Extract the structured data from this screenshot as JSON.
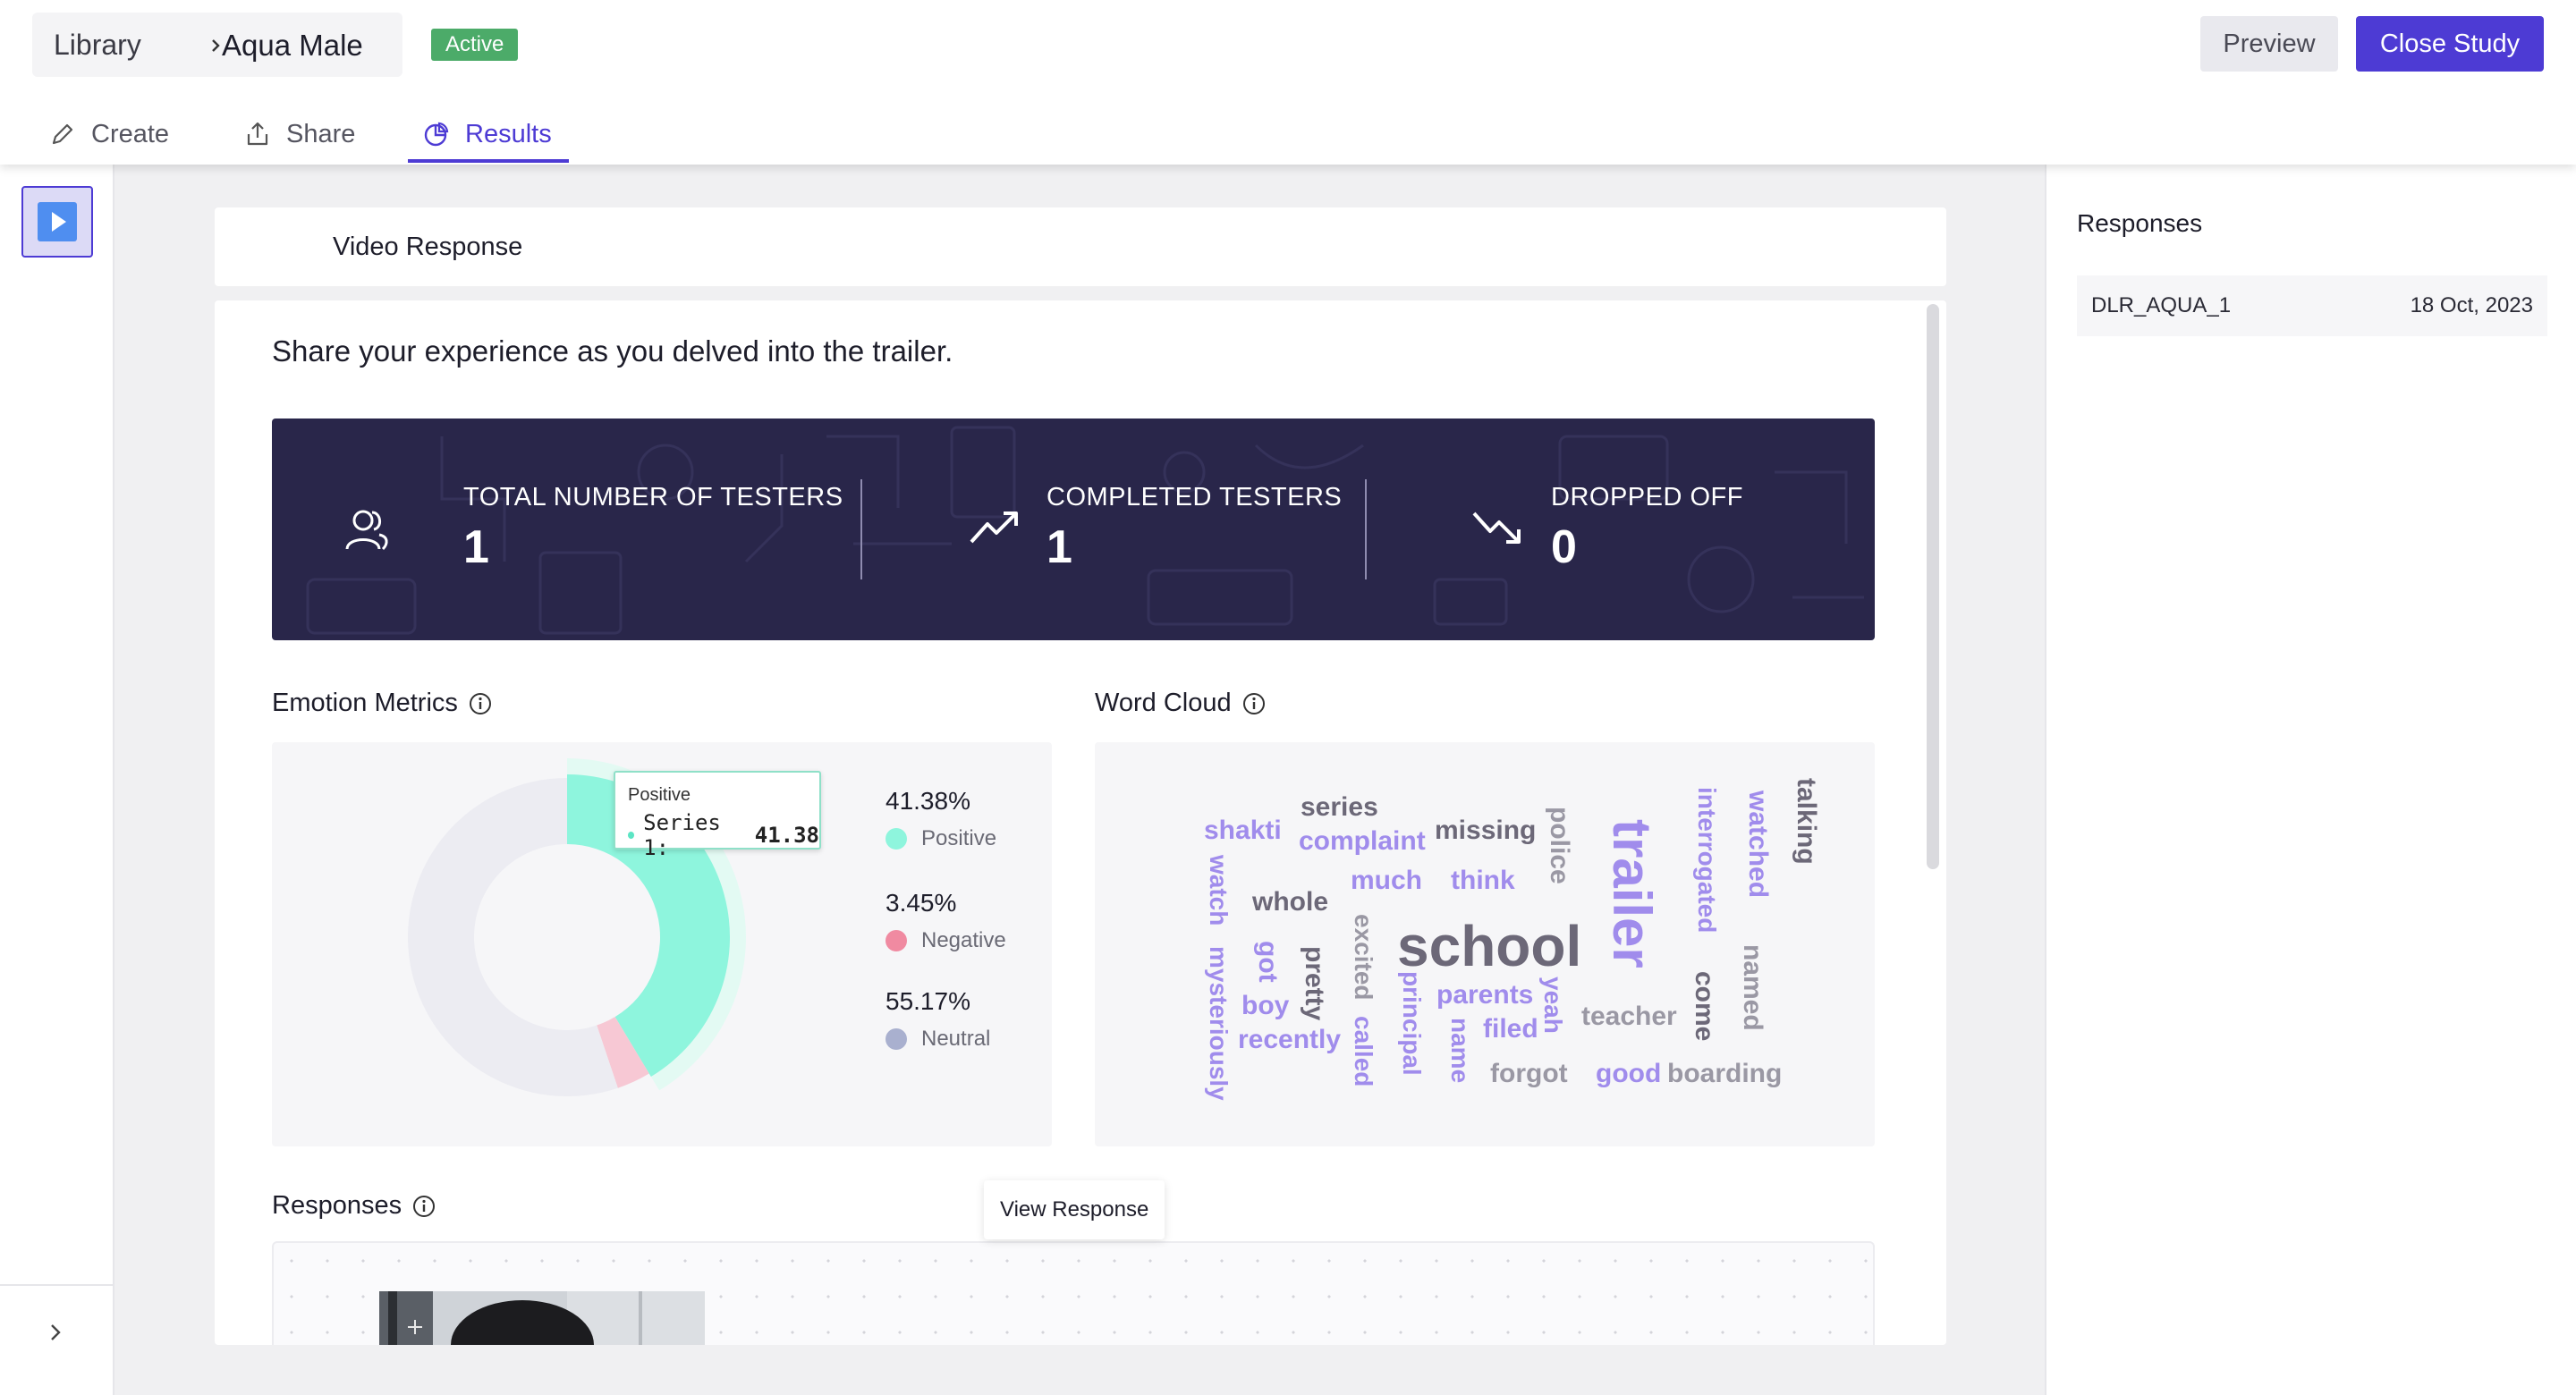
{
  "header": {
    "breadcrumb_root": "Library",
    "study_name": "Aqua Male",
    "status_badge": "Active",
    "preview_label": "Preview",
    "close_label": "Close Study",
    "tabs": [
      {
        "label": "Create",
        "icon": "pencil-icon"
      },
      {
        "label": "Share",
        "icon": "share-upload-icon"
      },
      {
        "label": "Results",
        "icon": "pie-chart-icon",
        "active": true
      }
    ]
  },
  "sidebar": {
    "items": [
      {
        "icon": "video-play-icon",
        "selected": true
      }
    ],
    "expand_icon": "chevron-right-icon"
  },
  "section": {
    "title": "Video Response"
  },
  "question": "Share your experience as you delved into the trailer.",
  "stats": [
    {
      "label": "TOTAL NUMBER OF TESTERS",
      "value": "1",
      "icon": "users-icon"
    },
    {
      "label": "COMPLETED TESTERS",
      "value": "1",
      "icon": "trend-up-icon"
    },
    {
      "label": "DROPPED OFF",
      "value": "0",
      "icon": "trend-down-icon"
    }
  ],
  "emotion_metrics": {
    "title": "Emotion Metrics",
    "tooltip": {
      "title": "Positive",
      "series": "Series 1:",
      "value": "41.38"
    },
    "legend": [
      {
        "pct": "41.38%",
        "label": "Positive",
        "color": "#8ef5dd"
      },
      {
        "pct": "3.45%",
        "label": "Negative",
        "color": "#f08aa1"
      },
      {
        "pct": "55.17%",
        "label": "Neutral",
        "color": "#a9b0cf"
      }
    ]
  },
  "chart_data": {
    "type": "pie",
    "categories": [
      "Positive",
      "Negative",
      "Neutral"
    ],
    "values": [
      41.38,
      3.45,
      55.17
    ],
    "colors": [
      "#8ef5dd",
      "#f7c8d4",
      "#ececf2"
    ],
    "series": [
      {
        "name": "Series 1",
        "values": [
          41.38,
          3.45,
          55.17
        ]
      }
    ]
  },
  "word_cloud": {
    "title": "Word Cloud",
    "words": [
      {
        "text": "school",
        "color": "#6c6878"
      },
      {
        "text": "trailer",
        "color": "#a08cec"
      },
      {
        "text": "series",
        "color": "#6c6878"
      },
      {
        "text": "shakti",
        "color": "#a08cec"
      },
      {
        "text": "complaint",
        "color": "#a08cec"
      },
      {
        "text": "missing",
        "color": "#6c6878"
      },
      {
        "text": "police",
        "color": "#9a98a4"
      },
      {
        "text": "interrogated",
        "color": "#a08cec"
      },
      {
        "text": "watched",
        "color": "#a08cec"
      },
      {
        "text": "talking",
        "color": "#6c6878"
      },
      {
        "text": "much",
        "color": "#a08cec"
      },
      {
        "text": "think",
        "color": "#a08cec"
      },
      {
        "text": "whole",
        "color": "#6c6878"
      },
      {
        "text": "watch",
        "color": "#a08cec"
      },
      {
        "text": "mysteriously",
        "color": "#a08cec"
      },
      {
        "text": "got",
        "color": "#a08cec"
      },
      {
        "text": "pretty",
        "color": "#6c6878"
      },
      {
        "text": "boy",
        "color": "#a08cec"
      },
      {
        "text": "recently",
        "color": "#a08cec"
      },
      {
        "text": "excited",
        "color": "#9a98a4"
      },
      {
        "text": "called",
        "color": "#a08cec"
      },
      {
        "text": "principal",
        "color": "#a08cec"
      },
      {
        "text": "name",
        "color": "#a08cec"
      },
      {
        "text": "parents",
        "color": "#a08cec"
      },
      {
        "text": "filed",
        "color": "#a08cec"
      },
      {
        "text": "yeah",
        "color": "#a08cec"
      },
      {
        "text": "teacher",
        "color": "#9a98a4"
      },
      {
        "text": "come",
        "color": "#6c6878"
      },
      {
        "text": "named",
        "color": "#9a98a4"
      },
      {
        "text": "forgot",
        "color": "#9a98a4"
      },
      {
        "text": "good",
        "color": "#a08cec"
      },
      {
        "text": "boarding",
        "color": "#9a98a4"
      }
    ]
  },
  "responses_section": {
    "title": "Responses",
    "view_tooltip": "View Response"
  },
  "right_panel": {
    "title": "Responses",
    "rows": [
      {
        "id": "DLR_AQUA_1",
        "date": "18 Oct, 2023"
      }
    ]
  },
  "colors": {
    "accent": "#4d3bd4",
    "badge": "#4cab69",
    "banner": "#29264a"
  }
}
